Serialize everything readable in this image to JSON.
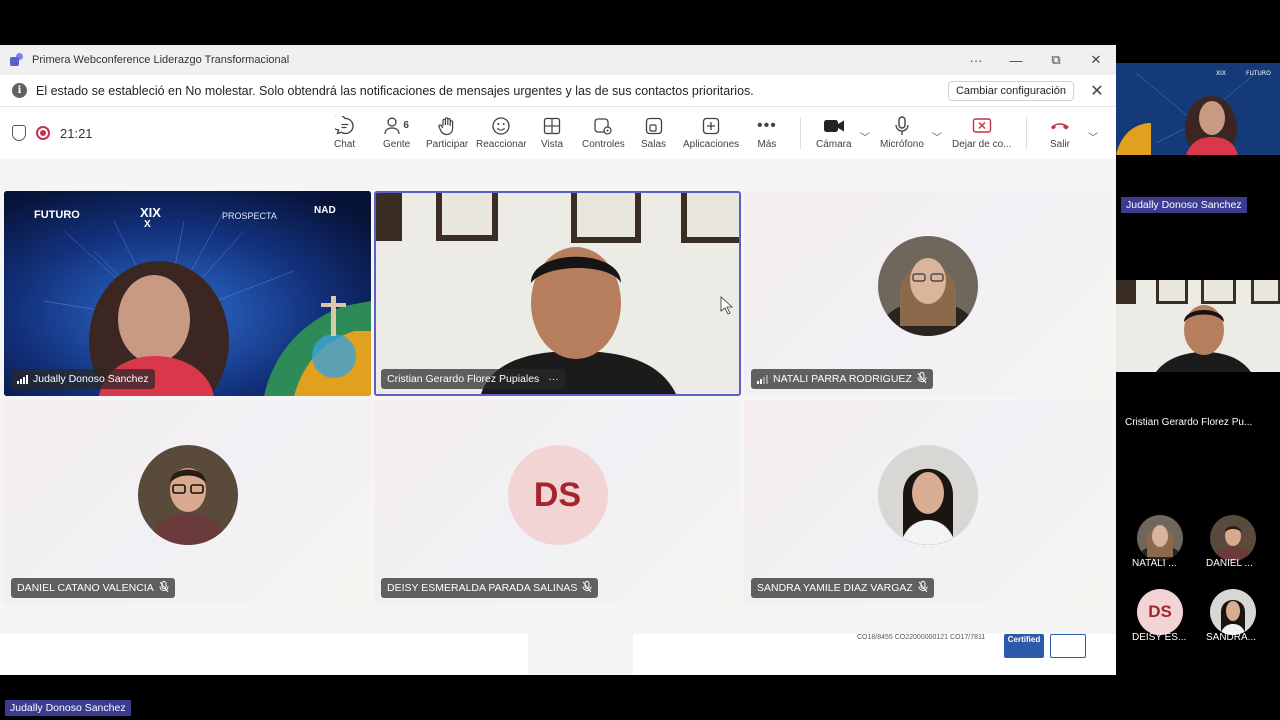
{
  "window": {
    "title": "Primera Webconference Liderazgo Transformacional",
    "more": "···",
    "minimize": "—",
    "restore": "⧉",
    "close": "✕"
  },
  "notice": {
    "text": "El estado se estableció en No molestar. Solo obtendrá las notificaciones de mensajes urgentes y las de sus contactos prioritarios.",
    "button": "Cambiar configuración",
    "close": "✕"
  },
  "toolbar": {
    "timer": "21:21",
    "people_count": "6",
    "items": {
      "chat": "Chat",
      "people": "Gente",
      "raise": "Participar",
      "react": "Reaccionar",
      "view": "Vista",
      "controls": "Controles",
      "rooms": "Salas",
      "apps": "Aplicaciones",
      "more": "Más",
      "camera": "Cámara",
      "mic": "Micrófono",
      "share": "Dejar de co...",
      "leave": "Salir"
    }
  },
  "participants": [
    {
      "name": "Judally Donoso Sanchez"
    },
    {
      "name": "Cristian Gerardo Florez Pupiales",
      "menu": "···"
    },
    {
      "name": "NATALI PARRA RODRIGUEZ"
    },
    {
      "name": "DANIEL CATANO VALENCIA"
    },
    {
      "name": "DEISY ESMERALDA PARADA SALINAS",
      "initials": "DS"
    },
    {
      "name": "SANDRA YAMILE DIAZ VARGAZ"
    }
  ],
  "slide": {
    "title_1": "XIX",
    "title_2": "X",
    "brand": "FUTURO",
    "brand2": "PROSPECTA",
    "brand3": "NAD"
  },
  "footer": {
    "codes": "CO18/8455   CO22000000121   CO17/7811",
    "badge": "Certified"
  },
  "right_panel": {
    "label_top": "Judally  Donoso Sanchez",
    "name_cristian": "Cristian Gerardo Florez Pu...",
    "small": [
      {
        "label": "NATALI ..."
      },
      {
        "label": "DANIEL ..."
      },
      {
        "label": "DEISY ES...",
        "initials": "DS"
      },
      {
        "label": "SANDRA..."
      }
    ]
  },
  "bottom_label": "Judally  Donoso Sanchez"
}
